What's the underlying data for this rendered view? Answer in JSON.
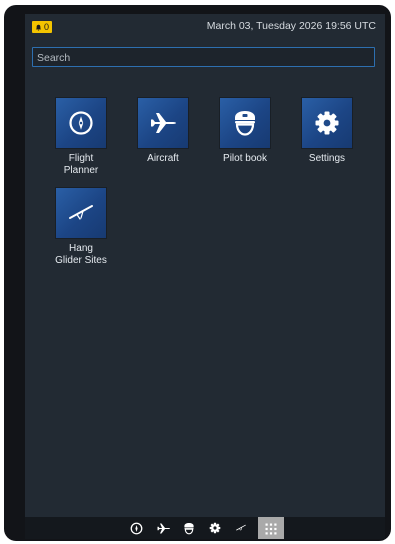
{
  "status_bar": {
    "alert_count": "0",
    "datetime": "March 03, Tuesday 2026 19:56 UTC"
  },
  "search": {
    "placeholder": "Search",
    "value": ""
  },
  "apps": [
    {
      "label": "Flight\nPlanner",
      "icon": "compass-icon"
    },
    {
      "label": "Aircraft",
      "icon": "airplane-icon"
    },
    {
      "label": "Pilot book",
      "icon": "pilot-cap-icon"
    },
    {
      "label": "Settings",
      "icon": "gear-icon"
    },
    {
      "label": "Hang\nGlider Sites",
      "icon": "hang-glider-icon"
    }
  ],
  "dock": {
    "items": [
      "compass-icon",
      "airplane-icon",
      "pilot-cap-icon",
      "gear-icon",
      "hang-glider-icon",
      "app-grid-icon"
    ],
    "active": "app-grid-icon"
  },
  "colors": {
    "screen_bg": "#222a33",
    "tile_bg": "#1f4a8a",
    "alert_badge": "#f3c400",
    "search_border": "#2d6fb0",
    "dock_active": "#a9a9a9"
  }
}
